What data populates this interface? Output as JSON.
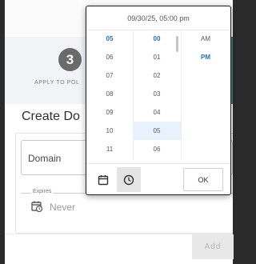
{
  "stepper": {
    "step_number": "3",
    "step_label": "APPLY TO POL"
  },
  "form": {
    "title": "Create Do",
    "domain_label": "Domain",
    "expires_label": "Expires",
    "expires_value": "Never",
    "add_label": "Add"
  },
  "picker": {
    "header": "09/30/25, 05:00 pm",
    "hours": [
      "05",
      "06",
      "07",
      "08",
      "09",
      "10",
      "11"
    ],
    "minutes": [
      "00",
      "01",
      "02",
      "03",
      "04",
      "05",
      "06"
    ],
    "ampm": [
      "AM",
      "PM"
    ],
    "selected_hour": "05",
    "selected_minute": "00",
    "selected_ampm": "PM",
    "ok_label": "OK",
    "icons": {
      "date_tab": "calendar-icon",
      "time_tab": "clock-icon"
    }
  },
  "colors": {
    "accent": "#1e6fd4",
    "teal": "#3f7f76",
    "step_circle": "#6a6a6a"
  }
}
